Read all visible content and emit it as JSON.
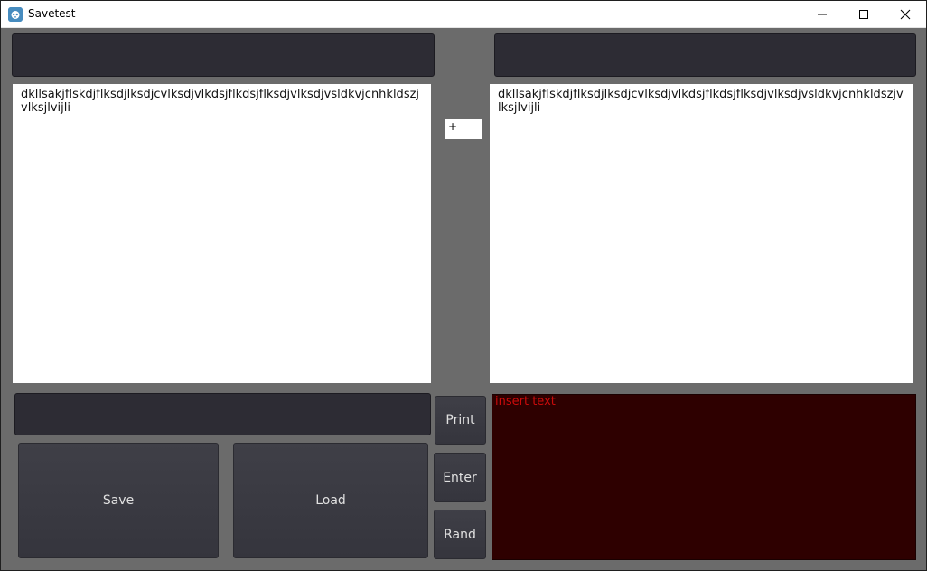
{
  "window": {
    "title": "Savetest",
    "controls": [
      "minimize-icon",
      "maximize-icon",
      "close-icon"
    ]
  },
  "left_panel": {
    "top_input_value": "",
    "text": "dkllsakjflskdjflksdjlksdjcvlksdjvlkdsjflkdsjflksdjvlksdjvsldkvjcnhkldszjvlksjlvijli"
  },
  "right_panel": {
    "top_input_value": "",
    "text": "dkllsakjflskdjflksdjlksdjcvlksdjvlkdsjflkdsjflksdjvlksdjvsldkvjcnhkldszjvlksjlvijli"
  },
  "operator_field": {
    "value": "+"
  },
  "bottom_left": {
    "input_value": "",
    "save_label": "Save",
    "load_label": "Load"
  },
  "side_buttons": {
    "print_label": "Print",
    "enter_label": "Enter",
    "rand_label": "Rand"
  },
  "console": {
    "placeholder": "insert text"
  },
  "colors": {
    "background": "#6b6b6b",
    "dark_field": "#2d2c34",
    "button": "#3f3f47",
    "console_bg": "#2e0000",
    "console_text": "#cc0b0b"
  }
}
